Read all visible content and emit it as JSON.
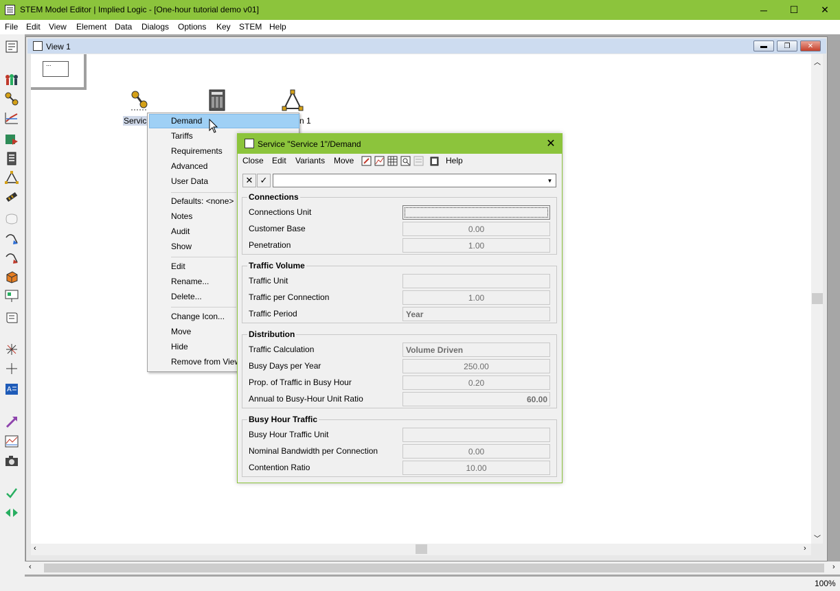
{
  "app": {
    "title": "STEM Model Editor | Implied Logic - [One-hour tutorial demo v01]",
    "title_bar_color": "#8cc43c"
  },
  "window_controls": {
    "minimize": "─",
    "maximize": "☐",
    "close": "✕"
  },
  "menubar": {
    "items": [
      "File",
      "Edit",
      "View",
      "Element",
      "Data",
      "Dialogs",
      "Options",
      "Key",
      "STEM",
      "Help"
    ]
  },
  "view": {
    "title": "View 1",
    "key_placeholder": "..."
  },
  "canvas": {
    "service_label": "Servic",
    "network_label": "n 1"
  },
  "context_menu": {
    "items": [
      "Demand",
      "Tariffs",
      "Requirements",
      "Advanced",
      "User Data",
      "Defaults: <none>",
      "Notes",
      "Audit",
      "Show",
      "Edit",
      "Rename...",
      "Delete...",
      "Change Icon...",
      "Move",
      "Hide",
      "Remove from View"
    ],
    "highlighted": "Demand"
  },
  "dialog": {
    "title": "Service \"Service 1\"/Demand",
    "close_icon": "✕",
    "menu": [
      "Close",
      "Edit",
      "Variants",
      "Move",
      "Help"
    ],
    "combo_value": "",
    "cancel_icon": "✕",
    "confirm_icon": "✓",
    "dropdown_icon": "▼",
    "groups": {
      "connections": {
        "title": "Connections",
        "fields": [
          {
            "label": "Connections Unit",
            "value": ""
          },
          {
            "label": "Customer Base",
            "value": "0.00"
          },
          {
            "label": "Penetration",
            "value": "1.00"
          }
        ]
      },
      "traffic_volume": {
        "title": "Traffic Volume",
        "fields": [
          {
            "label": "Traffic Unit",
            "value": ""
          },
          {
            "label": "Traffic per Connection",
            "value": "1.00"
          },
          {
            "label": "Traffic Period",
            "value": "Year"
          }
        ]
      },
      "distribution": {
        "title": "Distribution",
        "fields": [
          {
            "label": "Traffic Calculation",
            "value": "Volume Driven"
          },
          {
            "label": "Busy Days per Year",
            "value": "250.00"
          },
          {
            "label": "Prop. of Traffic in Busy Hour",
            "value": "0.20"
          },
          {
            "label": "Annual to Busy-Hour Unit Ratio",
            "value": "60.00"
          }
        ]
      },
      "busy_hour": {
        "title": "Busy Hour Traffic",
        "fields": [
          {
            "label": "Busy Hour Traffic Unit",
            "value": ""
          },
          {
            "label": "Nominal Bandwidth per Connection",
            "value": "0.00"
          },
          {
            "label": "Contention Ratio",
            "value": "10.00"
          }
        ]
      }
    }
  },
  "statusbar": {
    "zoom": "100%"
  },
  "toolbar_icons": [
    "report-icon",
    "resources-icon",
    "service-icon",
    "graph-icon",
    "location-icon",
    "equipment-icon",
    "network-icon",
    "cable-icon",
    "region-icon",
    "select-icon",
    "pick-icon",
    "box-icon",
    "layout-icon",
    "scroll-icon",
    "sparkle-icon",
    "crosshair-icon",
    "text-icon",
    "link-icon",
    "chart-icon",
    "camera-icon",
    "check-icon",
    "arrows-icon"
  ]
}
